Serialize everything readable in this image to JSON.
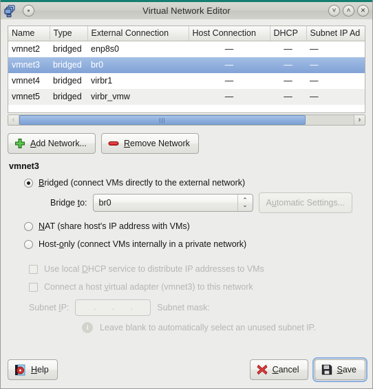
{
  "window": {
    "title": "Virtual Network Editor",
    "app_icon": "network-stack-icon",
    "shade_button": "shade-button",
    "minimize_label": "˅",
    "maximize_label": "˄",
    "close_label": "✕"
  },
  "table": {
    "columns": [
      "Name",
      "Type",
      "External Connection",
      "Host Connection",
      "DHCP",
      "Subnet IP Ad"
    ],
    "rows": [
      {
        "name": "vmnet2",
        "type": "bridged",
        "external": "enp8s0",
        "host": "—",
        "dhcp": "—",
        "subnet": "—",
        "selected": false
      },
      {
        "name": "vmnet3",
        "type": "bridged",
        "external": "br0",
        "host": "—",
        "dhcp": "—",
        "subnet": "—",
        "selected": true
      },
      {
        "name": "vmnet4",
        "type": "bridged",
        "external": "virbr1",
        "host": "—",
        "dhcp": "—",
        "subnet": "—",
        "selected": false
      },
      {
        "name": "vmnet5",
        "type": "bridged",
        "external": "virbr_vmw",
        "host": "—",
        "dhcp": "—",
        "subnet": "—",
        "selected": false
      }
    ],
    "scrollbar": {
      "left_arrow": "‹",
      "right_arrow": "›",
      "grip": "|||"
    }
  },
  "toolbar": {
    "add_prefix": "",
    "add_accel": "A",
    "add_suffix": "dd Network...",
    "remove_prefix": "",
    "remove_accel": "R",
    "remove_suffix": "emove Network"
  },
  "details": {
    "section_title": "vmnet3",
    "bridged": {
      "accel": "B",
      "rest": "ridged (connect VMs directly to the external network)",
      "selected": true
    },
    "bridge_to": {
      "label_pre": "Bridge ",
      "label_accel": "t",
      "label_post": "o:",
      "value": "br0",
      "up_arrow": "⌃",
      "down_arrow": "⌄"
    },
    "automatic_settings": {
      "pre": "A",
      "accel": "u",
      "post": "tomatic Settings...",
      "enabled": false
    },
    "nat": {
      "accel": "N",
      "rest": "AT (share host's IP address with VMs)",
      "selected": false
    },
    "host_only": {
      "pre": "Host-",
      "accel": "o",
      "post": "nly (connect VMs internally in a private network)",
      "selected": false
    },
    "dhcp_checkbox": {
      "pre": "Use local ",
      "accel": "D",
      "post": "HCP service to distribute IP addresses to VMs",
      "checked": false,
      "enabled": false
    },
    "host_adapter_checkbox": {
      "pre": "Connect a host ",
      "accel": "v",
      "post": "irtual adapter (vmnet3) to this network",
      "checked": false,
      "enabled": false
    },
    "subnet_ip": {
      "label_pre": "Subnet ",
      "label_accel": "I",
      "label_post": "P:",
      "value": "",
      "separators": [
        ".",
        ".",
        "."
      ],
      "enabled": false
    },
    "subnet_mask": {
      "label": "Subnet mask:",
      "value": ""
    },
    "hint": {
      "icon": "info-icon",
      "text": "Leave blank to automatically select an unused subnet IP."
    }
  },
  "footer": {
    "help": {
      "pre": "",
      "accel": "H",
      "post": "elp",
      "icon": "help-book-icon"
    },
    "cancel": {
      "pre": "",
      "accel": "C",
      "post": "ancel",
      "icon": "red-x-icon"
    },
    "save": {
      "pre": "",
      "accel": "S",
      "post": "ave",
      "icon": "floppy-disk-icon",
      "focused": true
    }
  },
  "colors": {
    "titlebar_accent": "#157e71",
    "selection_blue": "#92b0de",
    "window_bg": "#ececeb",
    "disabled_text": "#b6b6b1"
  }
}
